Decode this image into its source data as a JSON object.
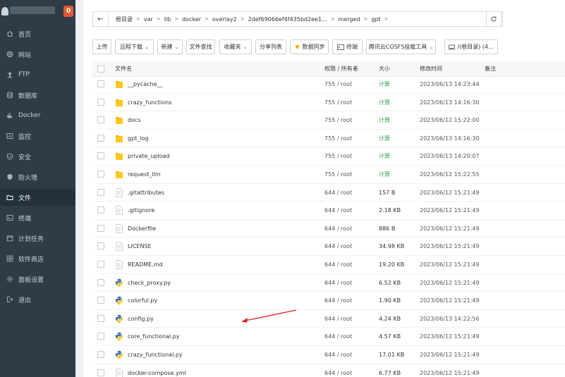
{
  "sidebar": {
    "badge": "0",
    "items": [
      {
        "label": "首页",
        "icon": "home-icon"
      },
      {
        "label": "网站",
        "icon": "globe-icon"
      },
      {
        "label": "FTP",
        "icon": "ftp-icon"
      },
      {
        "label": "数据库",
        "icon": "database-icon"
      },
      {
        "label": "Docker",
        "icon": "docker-icon"
      },
      {
        "label": "监控",
        "icon": "monitor-icon"
      },
      {
        "label": "安全",
        "icon": "shield-icon"
      },
      {
        "label": "防火墙",
        "icon": "firewall-icon"
      },
      {
        "label": "文件",
        "icon": "folder-icon",
        "active": true
      },
      {
        "label": "终端",
        "icon": "terminal-icon"
      },
      {
        "label": "计划任务",
        "icon": "calendar-icon"
      },
      {
        "label": "软件商店",
        "icon": "apps-icon"
      },
      {
        "label": "面板设置",
        "icon": "gear-icon"
      },
      {
        "label": "退出",
        "icon": "logout-icon"
      }
    ]
  },
  "breadcrumb": {
    "segments": [
      "根目录",
      "var",
      "lib",
      "docker",
      "overlay2",
      "2def69066ef4f435bd2ee1...",
      "merged",
      "gpt"
    ]
  },
  "toolbar": {
    "upload": "上传",
    "remote_download": "远程下载",
    "new": "新建",
    "file_search": "文件查找",
    "favorites": "收藏夹",
    "share_list": "分享列表",
    "data_sync": "数据同步",
    "terminal": "终端",
    "cos_mount": "腾讯云COSFS挂载工具",
    "disk": "/(根目录) (4..."
  },
  "table": {
    "headers": {
      "name": "文件名",
      "perm": "权限 / 所有者",
      "size": "大小",
      "mtime": "修改时间",
      "note": "备注"
    },
    "rows": [
      {
        "name": "__pycache__",
        "type": "folder",
        "perm": "755 / root",
        "size": "计算",
        "mtime": "2023/06/13 14:23:44"
      },
      {
        "name": "crazy_functions",
        "type": "folder",
        "perm": "755 / root",
        "size": "计算",
        "mtime": "2023/06/13 14:16:30"
      },
      {
        "name": "docs",
        "type": "folder",
        "perm": "755 / root",
        "size": "计算",
        "mtime": "2023/06/12 15:22:00"
      },
      {
        "name": "gpt_log",
        "type": "folder",
        "perm": "755 / root",
        "size": "计算",
        "mtime": "2023/06/13 14:16:30"
      },
      {
        "name": "private_upload",
        "type": "folder",
        "perm": "755 / root",
        "size": "计算",
        "mtime": "2023/06/13 14:20:07"
      },
      {
        "name": "request_llm",
        "type": "folder",
        "perm": "755 / root",
        "size": "计算",
        "mtime": "2023/06/12 15:22:55"
      },
      {
        "name": ".gitattributes",
        "type": "text",
        "perm": "644 / root",
        "size": "157 B",
        "mtime": "2023/06/12 15:21:49"
      },
      {
        "name": ".gitignore",
        "type": "text",
        "perm": "644 / root",
        "size": "2.18 KB",
        "mtime": "2023/06/12 15:21:49"
      },
      {
        "name": "Dockerfile",
        "type": "text",
        "perm": "644 / root",
        "size": "886 B",
        "mtime": "2023/06/12 15:21:49"
      },
      {
        "name": "LICENSE",
        "type": "text",
        "perm": "644 / root",
        "size": "34.98 KB",
        "mtime": "2023/06/12 15:21:49"
      },
      {
        "name": "README.md",
        "type": "text",
        "perm": "644 / root",
        "size": "19.20 KB",
        "mtime": "2023/06/12 15:21:49"
      },
      {
        "name": "check_proxy.py",
        "type": "python",
        "perm": "644 / root",
        "size": "6.52 KB",
        "mtime": "2023/06/12 15:21:49"
      },
      {
        "name": "colorful.py",
        "type": "python",
        "perm": "644 / root",
        "size": "1.90 KB",
        "mtime": "2023/06/12 15:21:49"
      },
      {
        "name": "config.py",
        "type": "python",
        "perm": "644 / root",
        "size": "4.24 KB",
        "mtime": "2023/06/13 14:22:56"
      },
      {
        "name": "core_functional.py",
        "type": "python",
        "perm": "644 / root",
        "size": "4.57 KB",
        "mtime": "2023/06/12 15:21:49"
      },
      {
        "name": "crazy_functional.py",
        "type": "python",
        "perm": "644 / root",
        "size": "17.01 KB",
        "mtime": "2023/06/12 15:21:49"
      },
      {
        "name": "docker-compose.yml",
        "type": "text",
        "perm": "644 / root",
        "size": "6.77 KB",
        "mtime": "2023/06/12 15:21:49"
      }
    ]
  },
  "colors": {
    "sidebar_bg": "#2f3b46",
    "sidebar_active": "#24303a",
    "badge": "#e25a34",
    "folder": "#f4b400",
    "calc_green": "#2ea94a",
    "arrow": "#d9262b"
  }
}
